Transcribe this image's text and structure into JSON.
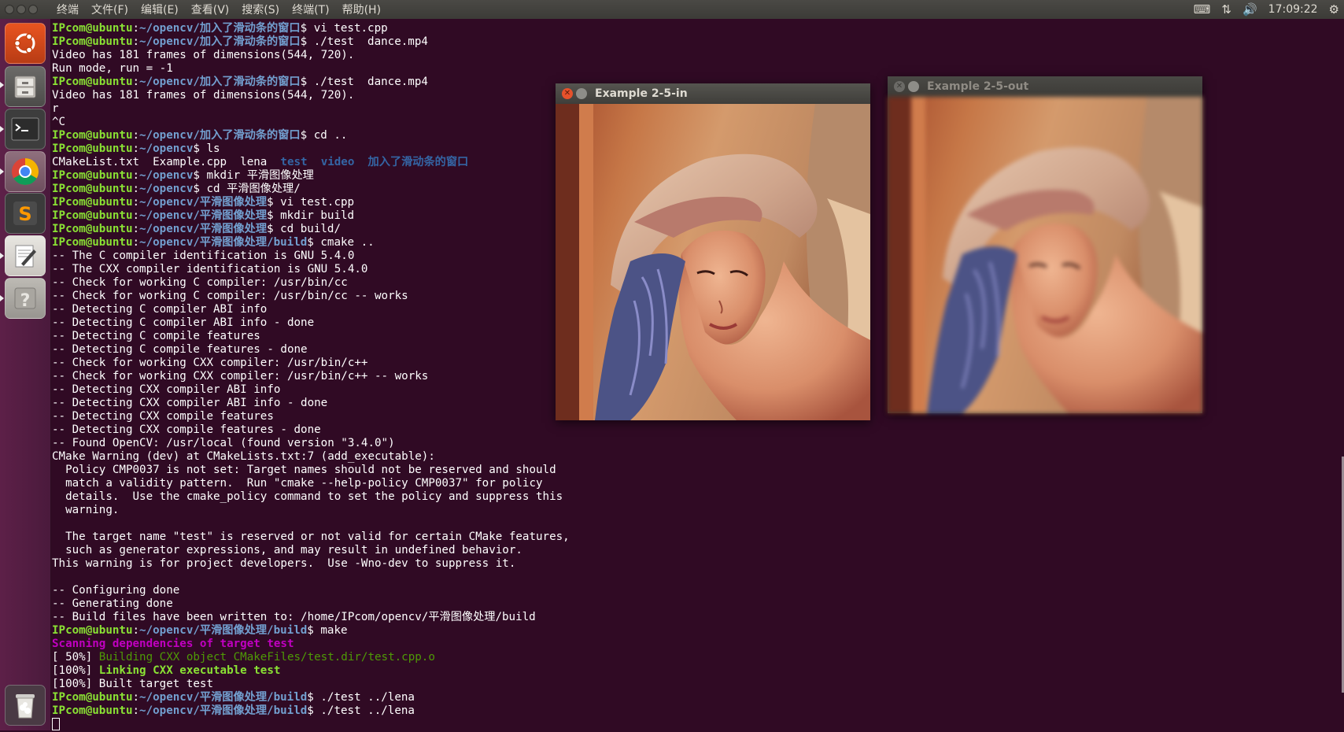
{
  "topbar": {
    "menus": [
      "终端",
      "文件(F)",
      "编辑(E)",
      "查看(V)",
      "搜索(S)",
      "终端(T)",
      "帮助(H)"
    ],
    "clock": "17:09:22"
  },
  "launcher": {
    "items": [
      "ubuntu-dash",
      "files",
      "terminal",
      "chrome",
      "sublime-text",
      "text-editor",
      "help",
      "trash"
    ]
  },
  "terminal": {
    "lines": [
      [
        [
          "pu",
          "IPcom@ubuntu"
        ],
        [
          "w",
          ":"
        ],
        [
          "pp",
          "~/opencv/加入了滑动条的窗口"
        ],
        [
          "w",
          "$ vi test.cpp"
        ]
      ],
      [
        [
          "pu",
          "IPcom@ubuntu"
        ],
        [
          "w",
          ":"
        ],
        [
          "pp",
          "~/opencv/加入了滑动条的窗口"
        ],
        [
          "w",
          "$ ./test  dance.mp4"
        ]
      ],
      [
        [
          "w",
          "Video has 181 frames of dimensions(544, 720)."
        ]
      ],
      [
        [
          "w",
          "Run mode, run = -1"
        ]
      ],
      [
        [
          "pu",
          "IPcom@ubuntu"
        ],
        [
          "w",
          ":"
        ],
        [
          "pp",
          "~/opencv/加入了滑动条的窗口"
        ],
        [
          "w",
          "$ ./test  dance.mp4"
        ]
      ],
      [
        [
          "w",
          "Video has 181 frames of dimensions(544, 720)."
        ]
      ],
      [
        [
          "w",
          "r"
        ]
      ],
      [
        [
          "w",
          "^C"
        ]
      ],
      [
        [
          "pu",
          "IPcom@ubuntu"
        ],
        [
          "w",
          ":"
        ],
        [
          "pp",
          "~/opencv/加入了滑动条的窗口"
        ],
        [
          "w",
          "$ cd .."
        ]
      ],
      [
        [
          "pu",
          "IPcom@ubuntu"
        ],
        [
          "w",
          ":"
        ],
        [
          "pp",
          "~/opencv"
        ],
        [
          "w",
          "$ ls"
        ]
      ],
      [
        [
          "w",
          "CMakeList.txt  Example.cpp  lena  "
        ],
        [
          "dir",
          "test"
        ],
        [
          "w",
          "  "
        ],
        [
          "dir",
          "video"
        ],
        [
          "w",
          "  "
        ],
        [
          "dir",
          "加入了滑动条的窗口"
        ]
      ],
      [
        [
          "pu",
          "IPcom@ubuntu"
        ],
        [
          "w",
          ":"
        ],
        [
          "pp",
          "~/opencv"
        ],
        [
          "w",
          "$ mkdir 平滑图像处理"
        ]
      ],
      [
        [
          "pu",
          "IPcom@ubuntu"
        ],
        [
          "w",
          ":"
        ],
        [
          "pp",
          "~/opencv"
        ],
        [
          "w",
          "$ cd 平滑图像处理/"
        ]
      ],
      [
        [
          "pu",
          "IPcom@ubuntu"
        ],
        [
          "w",
          ":"
        ],
        [
          "pp",
          "~/opencv/平滑图像处理"
        ],
        [
          "w",
          "$ vi test.cpp"
        ]
      ],
      [
        [
          "pu",
          "IPcom@ubuntu"
        ],
        [
          "w",
          ":"
        ],
        [
          "pp",
          "~/opencv/平滑图像处理"
        ],
        [
          "w",
          "$ mkdir build"
        ]
      ],
      [
        [
          "pu",
          "IPcom@ubuntu"
        ],
        [
          "w",
          ":"
        ],
        [
          "pp",
          "~/opencv/平滑图像处理"
        ],
        [
          "w",
          "$ cd build/"
        ]
      ],
      [
        [
          "pu",
          "IPcom@ubuntu"
        ],
        [
          "w",
          ":"
        ],
        [
          "pp",
          "~/opencv/平滑图像处理/build"
        ],
        [
          "w",
          "$ cmake .."
        ]
      ],
      [
        [
          "w",
          "-- The C compiler identification is GNU 5.4.0"
        ]
      ],
      [
        [
          "w",
          "-- The CXX compiler identification is GNU 5.4.0"
        ]
      ],
      [
        [
          "w",
          "-- Check for working C compiler: /usr/bin/cc"
        ]
      ],
      [
        [
          "w",
          "-- Check for working C compiler: /usr/bin/cc -- works"
        ]
      ],
      [
        [
          "w",
          "-- Detecting C compiler ABI info"
        ]
      ],
      [
        [
          "w",
          "-- Detecting C compiler ABI info - done"
        ]
      ],
      [
        [
          "w",
          "-- Detecting C compile features"
        ]
      ],
      [
        [
          "w",
          "-- Detecting C compile features - done"
        ]
      ],
      [
        [
          "w",
          "-- Check for working CXX compiler: /usr/bin/c++"
        ]
      ],
      [
        [
          "w",
          "-- Check for working CXX compiler: /usr/bin/c++ -- works"
        ]
      ],
      [
        [
          "w",
          "-- Detecting CXX compiler ABI info"
        ]
      ],
      [
        [
          "w",
          "-- Detecting CXX compiler ABI info - done"
        ]
      ],
      [
        [
          "w",
          "-- Detecting CXX compile features"
        ]
      ],
      [
        [
          "w",
          "-- Detecting CXX compile features - done"
        ]
      ],
      [
        [
          "w",
          "-- Found OpenCV: /usr/local (found version \"3.4.0\")"
        ]
      ],
      [
        [
          "w",
          "CMake Warning (dev) at CMakeLists.txt:7 (add_executable):"
        ]
      ],
      [
        [
          "w",
          "  Policy CMP0037 is not set: Target names should not be reserved and should"
        ]
      ],
      [
        [
          "w",
          "  match a validity pattern.  Run \"cmake --help-policy CMP0037\" for policy"
        ]
      ],
      [
        [
          "w",
          "  details.  Use the cmake_policy command to set the policy and suppress this"
        ]
      ],
      [
        [
          "w",
          "  warning."
        ]
      ],
      [
        [
          "w",
          ""
        ]
      ],
      [
        [
          "w",
          "  The target name \"test\" is reserved or not valid for certain CMake features,"
        ]
      ],
      [
        [
          "w",
          "  such as generator expressions, and may result in undefined behavior."
        ]
      ],
      [
        [
          "w",
          "This warning is for project developers.  Use -Wno-dev to suppress it."
        ]
      ],
      [
        [
          "w",
          ""
        ]
      ],
      [
        [
          "w",
          "-- Configuring done"
        ]
      ],
      [
        [
          "w",
          "-- Generating done"
        ]
      ],
      [
        [
          "w",
          "-- Build files have been written to: /home/IPcom/opencv/平滑图像处理/build"
        ]
      ],
      [
        [
          "pu",
          "IPcom@ubuntu"
        ],
        [
          "w",
          ":"
        ],
        [
          "pp",
          "~/opencv/平滑图像处理/build"
        ],
        [
          "w",
          "$ make"
        ]
      ],
      [
        [
          "scan",
          "Scanning dependencies of target test"
        ]
      ],
      [
        [
          "w",
          "[ 50%] "
        ],
        [
          "bld",
          "Building CXX object CMakeFiles/test.dir/test.cpp.o"
        ]
      ],
      [
        [
          "w",
          "[100%] "
        ],
        [
          "lnk",
          "Linking CXX executable test"
        ]
      ],
      [
        [
          "w",
          "[100%] Built target test"
        ]
      ],
      [
        [
          "pu",
          "IPcom@ubuntu"
        ],
        [
          "w",
          ":"
        ],
        [
          "pp",
          "~/opencv/平滑图像处理/build"
        ],
        [
          "w",
          "$ ./test ../lena"
        ]
      ],
      [
        [
          "pu",
          "IPcom@ubuntu"
        ],
        [
          "w",
          ":"
        ],
        [
          "pp",
          "~/opencv/平滑图像处理/build"
        ],
        [
          "w",
          "$ ./test ../lena"
        ]
      ]
    ]
  },
  "windows": {
    "in": {
      "title": "Example 2-5-in"
    },
    "out": {
      "title": "Example 2-5-out"
    }
  }
}
